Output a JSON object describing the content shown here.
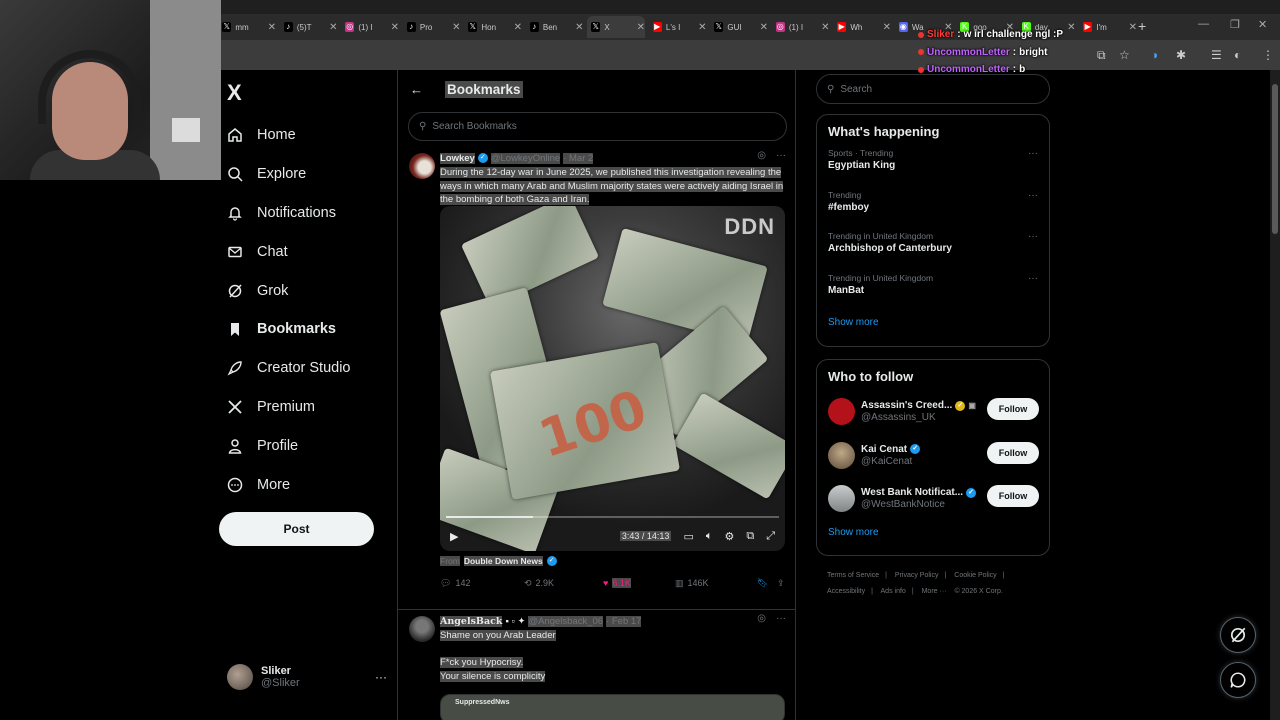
{
  "browser": {
    "tabs": [
      {
        "label": "mm",
        "icon": "x",
        "color": "#000000"
      },
      {
        "label": "(5)T",
        "icon": "tiktok",
        "color": "#000000"
      },
      {
        "label": "(1) I",
        "icon": "instagram",
        "color": "#c13584"
      },
      {
        "label": "Pro",
        "icon": "tiktok",
        "color": "#000000"
      },
      {
        "label": "Hon",
        "icon": "x",
        "color": "#000000"
      },
      {
        "label": "Ben",
        "icon": "tiktok",
        "color": "#000000"
      },
      {
        "label": "X",
        "icon": "x",
        "color": "#000000",
        "active": true
      },
      {
        "label": "L's I",
        "icon": "youtube",
        "color": "#ff0000"
      },
      {
        "label": "GUI",
        "icon": "x",
        "color": "#000000"
      },
      {
        "label": "(1) I",
        "icon": "instagram",
        "color": "#c13584"
      },
      {
        "label": "Wh",
        "icon": "youtube",
        "color": "#ff0000"
      },
      {
        "label": "Wa",
        "icon": "discord",
        "color": "#5865f2"
      },
      {
        "label": "goo",
        "icon": "kick",
        "color": "#53fc18"
      },
      {
        "label": "day",
        "icon": "kick",
        "color": "#53fc18"
      },
      {
        "label": "I'm",
        "icon": "youtube",
        "color": "#ff0000"
      }
    ]
  },
  "stream_chat": [
    {
      "user": "Sliker",
      "message": "w irl challenge ngl :P",
      "user_color": "#ff3a3a"
    },
    {
      "user": "UncommonLetter",
      "message": "bright",
      "user_color": "#c062ff"
    },
    {
      "user": "UncommonLetter",
      "message": "b",
      "user_color": "#c062ff"
    }
  ],
  "sidebar": {
    "logo": "X",
    "items": [
      {
        "label": "Home",
        "icon": "home-icon"
      },
      {
        "label": "Explore",
        "icon": "search-icon"
      },
      {
        "label": "Notifications",
        "icon": "bell-icon"
      },
      {
        "label": "Chat",
        "icon": "mail-icon"
      },
      {
        "label": "Grok",
        "icon": "grok-icon"
      },
      {
        "label": "Bookmarks",
        "icon": "bookmark-icon",
        "active": true
      },
      {
        "label": "Creator Studio",
        "icon": "rocket-icon"
      },
      {
        "label": "Premium",
        "icon": "x-icon"
      },
      {
        "label": "Profile",
        "icon": "person-icon"
      },
      {
        "label": "More",
        "icon": "more-circle-icon"
      }
    ],
    "post_label": "Post",
    "account": {
      "name": "Sliker",
      "handle": "@Sliker",
      "more": "···"
    }
  },
  "main": {
    "title": "Bookmarks",
    "search_placeholder": "Search Bookmarks",
    "tweets": [
      {
        "name": "Lowkey",
        "handle": "@LowkeyOnline",
        "date": "· Mar 2",
        "text": "During the 12-day war in June 2025, we published this investigation revealing the ways in which many Arab and Muslim majority states were actively aiding Israel in the bombing of both Gaza and Iran.",
        "video": {
          "watermark": "DDN",
          "time": "3:43 / 14:13",
          "progress": 0.26,
          "bill_value": "100"
        },
        "from_prefix": "From",
        "from_source": "Double Down News",
        "metrics": {
          "replies": "142",
          "reposts": "2.9K",
          "likes": "6.1K",
          "views": "146K"
        }
      },
      {
        "name": "AngelsBack",
        "handle": "@Angelsback_06",
        "date": "· Feb 17",
        "lines": [
          "Shame on you Arab Leader",
          "F*ck you Hypocrisy.",
          "Your silence is complicity"
        ],
        "preview_label": "SuppressedNws"
      }
    ]
  },
  "right": {
    "search_placeholder": "Search",
    "happening_title": "What's happening",
    "trends": [
      {
        "context": "Sports · Trending",
        "title": "Egyptian King"
      },
      {
        "context": "Trending",
        "title": "#femboy"
      },
      {
        "context": "Trending in United Kingdom",
        "title": "Archbishop of Canterbury"
      },
      {
        "context": "Trending in United Kingdom",
        "title": "ManBat"
      }
    ],
    "show_more": "Show more",
    "follow_title": "Who to follow",
    "follows": [
      {
        "name": "Assassin's Creed...",
        "handle": "@Assassins_UK",
        "badge": "gold",
        "avatar_color": "#b3121a"
      },
      {
        "name": "Kai Cenat",
        "handle": "@KaiCenat",
        "badge": "blue",
        "avatar_color": "#8a7a60"
      },
      {
        "name": "West Bank Notificat...",
        "handle": "@WestBankNotice",
        "badge": "blue",
        "avatar_color": "#9aa0a0"
      }
    ],
    "follow_label": "Follow",
    "footer": [
      "Terms of Service",
      "|",
      "Privacy Policy",
      "|",
      "Cookie Policy",
      "|",
      "Accessibility",
      "|",
      "Ads info",
      "|",
      "More ···",
      "© 2026 X Corp."
    ]
  }
}
